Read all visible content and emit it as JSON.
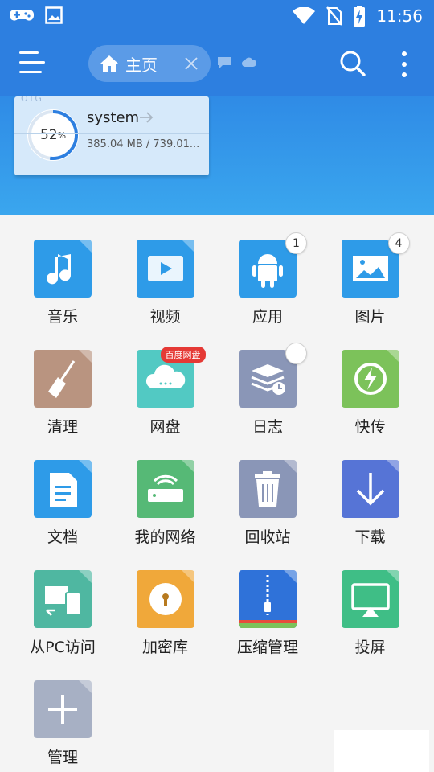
{
  "status_bar": {
    "time": "11:56",
    "left_icons": [
      "gamepad-icon",
      "image-icon"
    ],
    "right_icons": [
      "wifi-icon",
      "no-sim-icon",
      "battery-charging-icon"
    ]
  },
  "toolbar": {
    "tab_label": "主页",
    "menu_icon": "hamburger-menu-icon",
    "search_icon": "search-icon",
    "more_icon": "more-vertical-icon",
    "extra_icons": [
      "chat-icon",
      "cloud-icon"
    ]
  },
  "storage": {
    "badge": "OTG",
    "name": "system",
    "percent": "52",
    "percent_unit": "%",
    "usage_fraction": 0.52,
    "size_text": "385.04 MB / 739.01..."
  },
  "grid": [
    {
      "label": "音乐",
      "icon": "music-note-icon",
      "color": "#2e9be8",
      "badge": ""
    },
    {
      "label": "视频",
      "icon": "video-play-icon",
      "color": "#2e9be8",
      "badge": ""
    },
    {
      "label": "应用",
      "icon": "android-icon",
      "color": "#2e9be8",
      "badge": "1"
    },
    {
      "label": "图片",
      "icon": "picture-icon",
      "color": "#2e9be8",
      "badge": "4"
    },
    {
      "label": "清理",
      "icon": "broom-icon",
      "color": "#b99480",
      "badge": ""
    },
    {
      "label": "网盘",
      "icon": "cloud-drive-icon",
      "color": "#52c9c3",
      "badge": "",
      "tag": "百度网盘"
    },
    {
      "label": "日志",
      "icon": "log-layers-icon",
      "color": "#8a96b7",
      "badge": " "
    },
    {
      "label": "快传",
      "icon": "transfer-bolt-icon",
      "color": "#7cc25a",
      "badge": ""
    },
    {
      "label": "文档",
      "icon": "document-icon",
      "color": "#2e9be8",
      "badge": ""
    },
    {
      "label": "我的网络",
      "icon": "network-router-icon",
      "color": "#56b976",
      "badge": ""
    },
    {
      "label": "回收站",
      "icon": "trash-icon",
      "color": "#8a96b7",
      "badge": ""
    },
    {
      "label": "下载",
      "icon": "download-arrow-icon",
      "color": "#5674d6",
      "badge": ""
    },
    {
      "label": "从PC访问",
      "icon": "pc-phone-icon",
      "color": "#4fb7a1",
      "badge": ""
    },
    {
      "label": "加密库",
      "icon": "lock-vault-icon",
      "color": "#f0a83a",
      "badge": ""
    },
    {
      "label": "压缩管理",
      "icon": "zip-icon",
      "color": "#2f72d9",
      "badge": ""
    },
    {
      "label": "投屏",
      "icon": "cast-screen-icon",
      "color": "#3fbe86",
      "badge": ""
    },
    {
      "label": "管理",
      "icon": "plus-icon",
      "color": "#a7b0c4",
      "badge": ""
    }
  ]
}
